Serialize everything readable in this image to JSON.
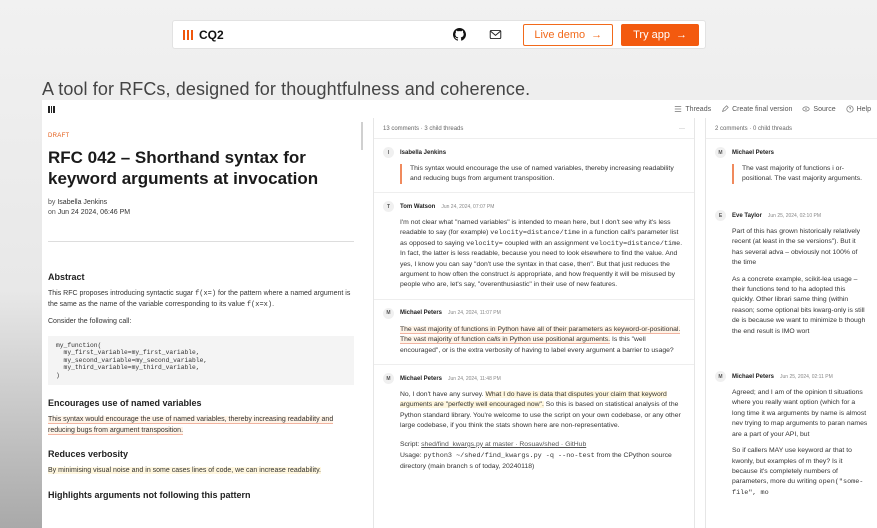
{
  "nav": {
    "brand": "CQ2",
    "live_demo": "Live demo",
    "try_app": "Try app",
    "arrow": "→"
  },
  "tagline": "A tool for RFCs, designed for thoughtfulness and coherence.",
  "app_header": {
    "threads": "Threads",
    "create_final": "Create final version",
    "source": "Source",
    "help": "Help"
  },
  "doc": {
    "status": "DRAFT",
    "title": "RFC 042 – Shorthand syntax for keyword arguments at invocation",
    "by_label": "by",
    "author": "Isabella Jenkins",
    "on_label": "on",
    "date": "Jun 24 2024, 06:46 PM",
    "abstract_heading": "Abstract",
    "abstract_1": "This RFC proposes introducing syntactic sugar",
    "abstract_code1": "f(x=)",
    "abstract_2": "for the pattern where a named argument is the same as the name of the variable corresponding to its value",
    "abstract_code2": "f(x=x)",
    "abstract_3": ".",
    "consider": "Consider the following call:",
    "code": "my_function(\n  my_first_variable=my_first_variable,\n  my_second_variable=my_second_variable,\n  my_third_variable=my_third_variable,\n)",
    "sec1_heading": "Encourages use of named variables",
    "sec1_text": "This syntax would encourage the use of named variables, thereby increasing readability and reducing bugs from argument transposition.",
    "sec2_heading": "Reduces verbosity",
    "sec2_text": "By minimising visual noise and in some cases lines of code, we can increase readability.",
    "sec3_heading": "Highlights arguments not following this pattern"
  },
  "thread1": {
    "header_comments": "13 comments",
    "header_sep": "·",
    "header_children": "3 child threads",
    "more": "···",
    "c1": {
      "initial": "I",
      "author": "Isabella Jenkins",
      "quote": "This syntax would encourage the use of named variables, thereby increasing readability and reducing bugs from argument transposition."
    },
    "c2": {
      "initial": "T",
      "author": "Tom Watson",
      "date": "Jun 24, 2024, 07:07 PM",
      "t1": "I'm not clear what \"named variables\" is intended to mean here, but I don't see why it's less readable to say (for example)",
      "code1": "velocity=distance/time",
      "t2": "in a function call's parameter list as opposed to saying",
      "code2": "velocity=",
      "t3": "coupled with an assignment",
      "code3": "velocity=distance/time",
      "t4": ". In fact, the latter is less readable, because you need to look elsewhere to find the value. And yes, I know you can say \"don't use the syntax in that case, then\". But that just reduces the argument to how often the construct",
      "em": "is",
      "t5": "appropriate, and how frequently it will be misused by people who are, let's say, \"overenthusiastic\" in their use of new features."
    },
    "c3": {
      "initial": "M",
      "author": "Michael Peters",
      "date": "Jun 24, 2024, 11:07 PM",
      "hl1": "The vast majority of functions in Python have all of their parameters as keyword-or-positional. The vast majority of function",
      "em": "calls",
      "hl2": "in Python use positional arguments.",
      "t1": "Is this \"well encouraged\", or is the extra verbosity of having to label every argument a barrier to usage?"
    },
    "c4": {
      "initial": "M",
      "author": "Michael Peters",
      "date": "Jun 24, 2024, 11:48 PM",
      "t1": "No, I don't have any survey.",
      "hl": "What I do have is data that disputes your claim that keyword arguments are \"perfectly well encouraged now\".",
      "t2": "So this is based on statistical analysis of the Python standard library. You're welcome to use the script on your own codebase, or any other large codebase, if you think the stats shown here are non-representative.",
      "script_label": "Script:",
      "script_link": "shed/find_kwargs.py at master · Rosuav/shed · GitHub",
      "usage_label": "Usage:",
      "usage_code": "python3 ~/shed/find_kwargs.py -q --no-test",
      "usage_t": "from the CPython source directory (main branch s of today, 20240118)"
    }
  },
  "thread2": {
    "header_comments": "2 comments",
    "header_sep": "·",
    "header_children": "0 child threads",
    "c1": {
      "initial": "M",
      "author": "Michael Peters",
      "quote": "The vast majority of functions i or-positional. The vast majority arguments."
    },
    "c2": {
      "initial": "E",
      "author": "Eve Taylor",
      "date": "Jun 25, 2024, 02:10 PM",
      "p1": "Part of this has grown historically relatively recent (at least in the se versions\"). But it has several adva – obviously not 100% of the time",
      "p2": "As a concrete example, scikit-lea usage – their functions tend to ha adopted this quickly. Other librari same thing (within reason; some optional bits kwarg-only is still de is because we want to minimize b though the end result is IMO wort"
    },
    "c3": {
      "initial": "M",
      "author": "Michael Peters",
      "date": "Jun 25, 2024, 02:11 PM",
      "p1": "Agreed; and I am of the opinion tl situations where you really want option (which for a long time it wa arguments by name is almost nev trying to map arguments to paran names are a part of your API, but",
      "p2a": "So if callers MAY use keyword ar that to kwonly, but examples of m they? Is it because it's completely numbers of parameters, more du writing",
      "p2code": "open(\"some-file\", mo"
    }
  },
  "colors": {
    "accent": "#f35a0f",
    "quote_border": "#f08a5d",
    "highlight": "#fff4e8"
  }
}
